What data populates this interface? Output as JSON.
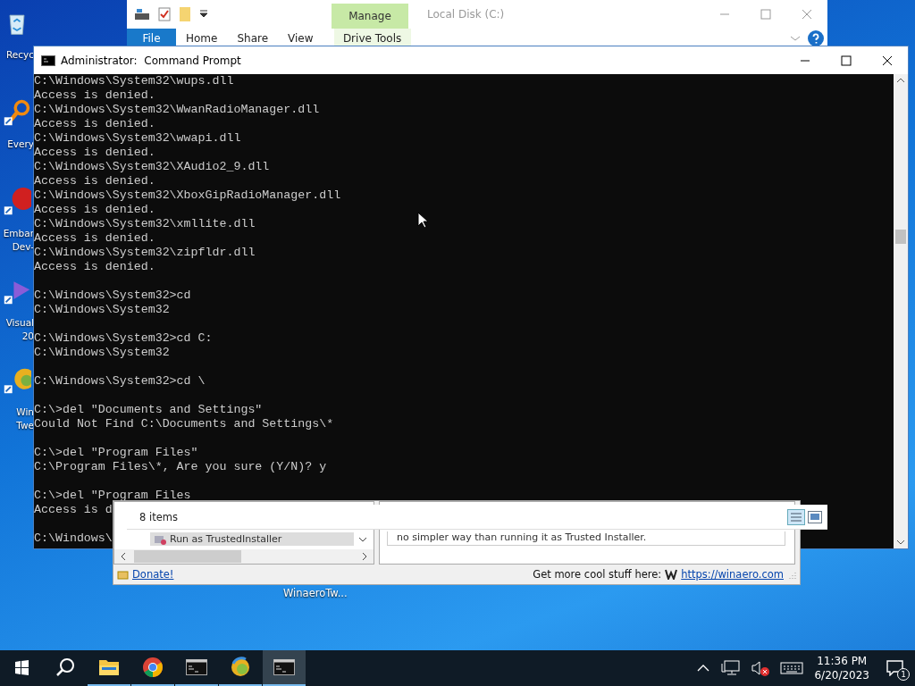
{
  "desktop_icons": [
    {
      "kind": "recycle",
      "lines": [
        "Recyc"
      ]
    },
    {
      "kind": "search",
      "lines": [
        "Every"
      ]
    },
    {
      "kind": "dev",
      "lines": [
        "Embar",
        "Dev-"
      ]
    },
    {
      "kind": "vs",
      "lines": [
        "Visual",
        "20"
      ]
    },
    {
      "kind": "tweaker",
      "lines": [
        "Win",
        "Twe"
      ]
    }
  ],
  "desktop_label": "WinaeroTw...",
  "explorer": {
    "title": "Local Disk (C:)",
    "context_label": "Manage",
    "tabs": [
      {
        "label": "File",
        "kind": "file"
      },
      {
        "label": "Home",
        "kind": "tab"
      },
      {
        "label": "Share",
        "kind": "tab"
      },
      {
        "label": "View",
        "kind": "tab"
      },
      {
        "label": "Drive Tools",
        "kind": "context"
      }
    ],
    "status": "8 items"
  },
  "cmd": {
    "title": "Administrator:  Command Prompt",
    "cursor": true,
    "blocks": [
      [
        "C:\\Windows\\System32\\wups.dll",
        "Access is denied.",
        "C:\\Windows\\System32\\WwanRadioManager.dll",
        "Access is denied.",
        "C:\\Windows\\System32\\wwapi.dll",
        "Access is denied.",
        "C:\\Windows\\System32\\XAudio2_9.dll",
        "Access is denied.",
        "C:\\Windows\\System32\\XboxGipRadioManager.dll",
        "Access is denied.",
        "C:\\Windows\\System32\\xmllite.dll",
        "Access is denied.",
        "C:\\Windows\\System32\\zipfldr.dll",
        "Access is denied."
      ],
      [
        "C:\\Windows\\System32>cd",
        "C:\\Windows\\System32"
      ],
      [
        "C:\\Windows\\System32>cd C:",
        "C:\\Windows\\System32"
      ],
      [
        "C:\\Windows\\System32>cd \\"
      ],
      [
        "C:\\>del \"Documents and Settings\"",
        "Could Not Find C:\\Documents and Settings\\*"
      ],
      [
        "C:\\>del \"Program Files\"",
        "C:\\Program Files\\*, Are you sure (Y/N)? y"
      ],
      [
        "C:\\>del \"Program Files",
        "Access is d"
      ],
      [
        "C:\\Windows\\"
      ]
    ]
  },
  "tweaker": {
    "tree_item": "Run as TrustedInstaller",
    "description": "no simpler way than running it as Trusted Installer.",
    "donate": "Donate!",
    "promo": "Get more cool stuff here:",
    "link": "https://winaero.com"
  },
  "taskbar": {
    "apps": [
      {
        "kind": "explorer",
        "selected": false
      },
      {
        "kind": "chrome",
        "selected": false
      },
      {
        "kind": "cmd",
        "selected": false
      },
      {
        "kind": "tweaker",
        "selected": false
      },
      {
        "kind": "cmd",
        "selected": true
      }
    ],
    "time": "11:36 PM",
    "date": "6/20/2023",
    "notifications": "1"
  }
}
